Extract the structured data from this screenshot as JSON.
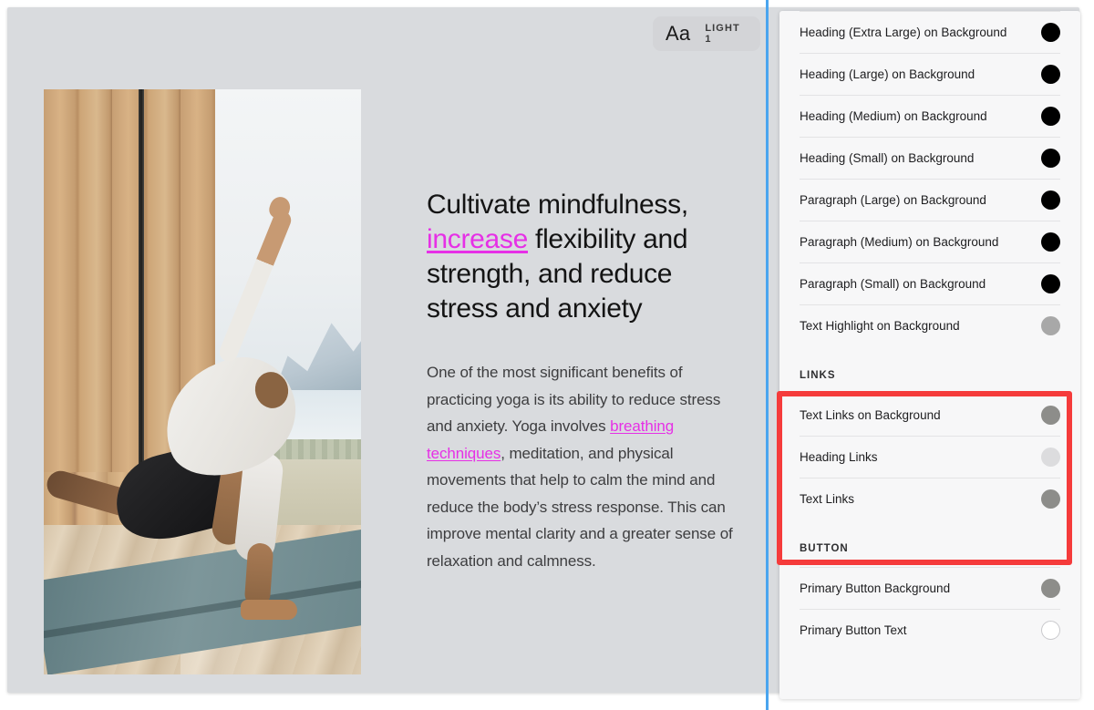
{
  "font_badge": {
    "sample_text": "Aa",
    "style_name": "LIGHT 1"
  },
  "preview": {
    "headline": {
      "before": "Cultivate mindfulness, ",
      "link": "increase",
      "after": " flexibility and strength, and reduce stress and anxiety"
    },
    "paragraph": {
      "before": "One of the most significant benefits of practicing yoga is its ability to reduce stress and anxiety. Yoga involves ",
      "link": "breathing techniques",
      "after": ", meditation, and physical movements that help to calm the mind and reduce the body’s stress response. This can improve mental clarity and a greater sense of relaxation and calmness."
    },
    "image_alt": "person practicing extended side angle yoga pose on a teal mat in a wooden cabin with mountain lake view"
  },
  "inspector": {
    "sections": [
      {
        "title": "",
        "rows": [
          {
            "label": "Heading (Extra Large) on Background",
            "color": "#000000"
          },
          {
            "label": "Heading (Large) on Background",
            "color": "#000000"
          },
          {
            "label": "Heading (Medium) on Background",
            "color": "#000000"
          },
          {
            "label": "Heading (Small) on Background",
            "color": "#000000"
          },
          {
            "label": "Paragraph (Large) on Background",
            "color": "#000000"
          },
          {
            "label": "Paragraph (Medium) on Background",
            "color": "#000000"
          },
          {
            "label": "Paragraph (Small) on Background",
            "color": "#000000"
          },
          {
            "label": "Text Highlight on Background",
            "color": "#a8a8a8"
          }
        ]
      },
      {
        "title": "LINKS",
        "rows": [
          {
            "label": "Text Links on Background",
            "color": "#8d8d8a"
          },
          {
            "label": "Heading Links",
            "color": "#dcdcde"
          },
          {
            "label": "Text Links",
            "color": "#8d8d8a"
          }
        ]
      },
      {
        "title": "BUTTON",
        "rows": [
          {
            "label": "Primary Button Background",
            "color": "#8d8d8a"
          },
          {
            "label": "Primary Button Text",
            "color": "#ffffff"
          }
        ]
      }
    ]
  },
  "colors": {
    "accent_link": "#e630e6",
    "divider_blue": "#4aa5ef",
    "annotation_red": "#f53b3b",
    "canvas_bg": "#d9dbde",
    "panel_bg": "#f7f7f8"
  }
}
